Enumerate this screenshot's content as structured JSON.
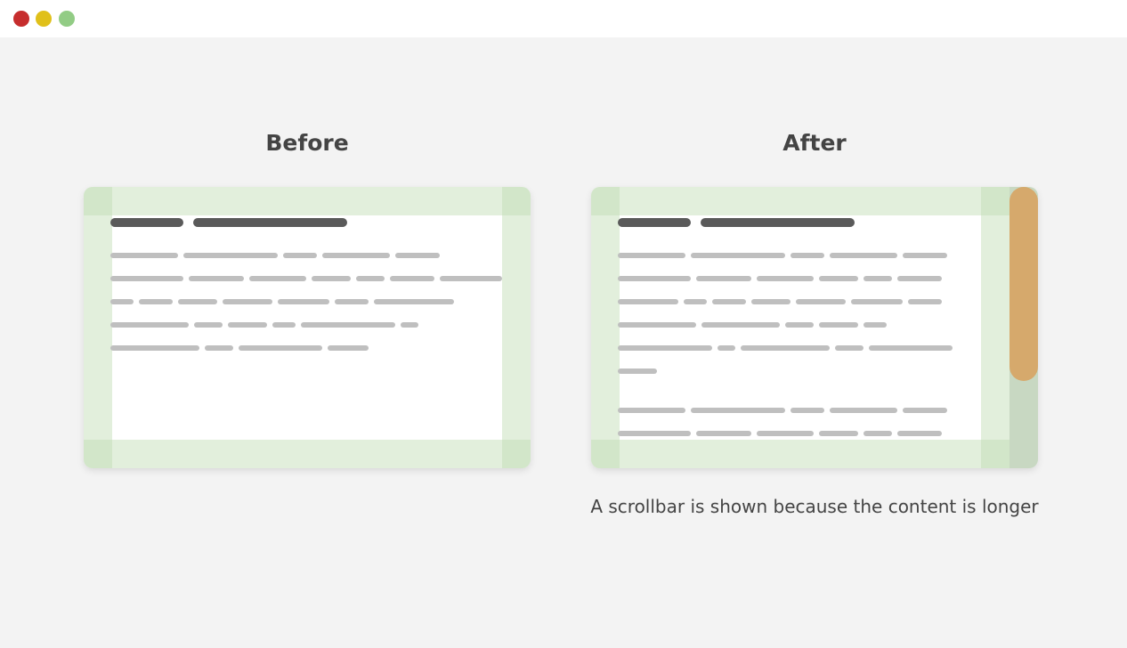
{
  "window": {
    "controls": [
      {
        "name": "close",
        "color": "#c62d2d"
      },
      {
        "name": "minimize",
        "color": "#e0c01a"
      },
      {
        "name": "maximize",
        "color": "#92cc85"
      }
    ]
  },
  "before": {
    "heading": "Before"
  },
  "after": {
    "heading": "After",
    "caption": "A scrollbar is shown because the content is longer",
    "scrollbar": {
      "thumb_fraction": 0.69,
      "scroll_position": 0
    }
  },
  "colors": {
    "background": "#f3f3f3",
    "padding": "#e2efdc",
    "padding_corner": "#d2e6c9",
    "heading_line": "#5a5a5a",
    "text_line": "#bfbfbf",
    "scroll_track": "#c8d8c2",
    "scroll_thumb": "#d6a96c"
  }
}
